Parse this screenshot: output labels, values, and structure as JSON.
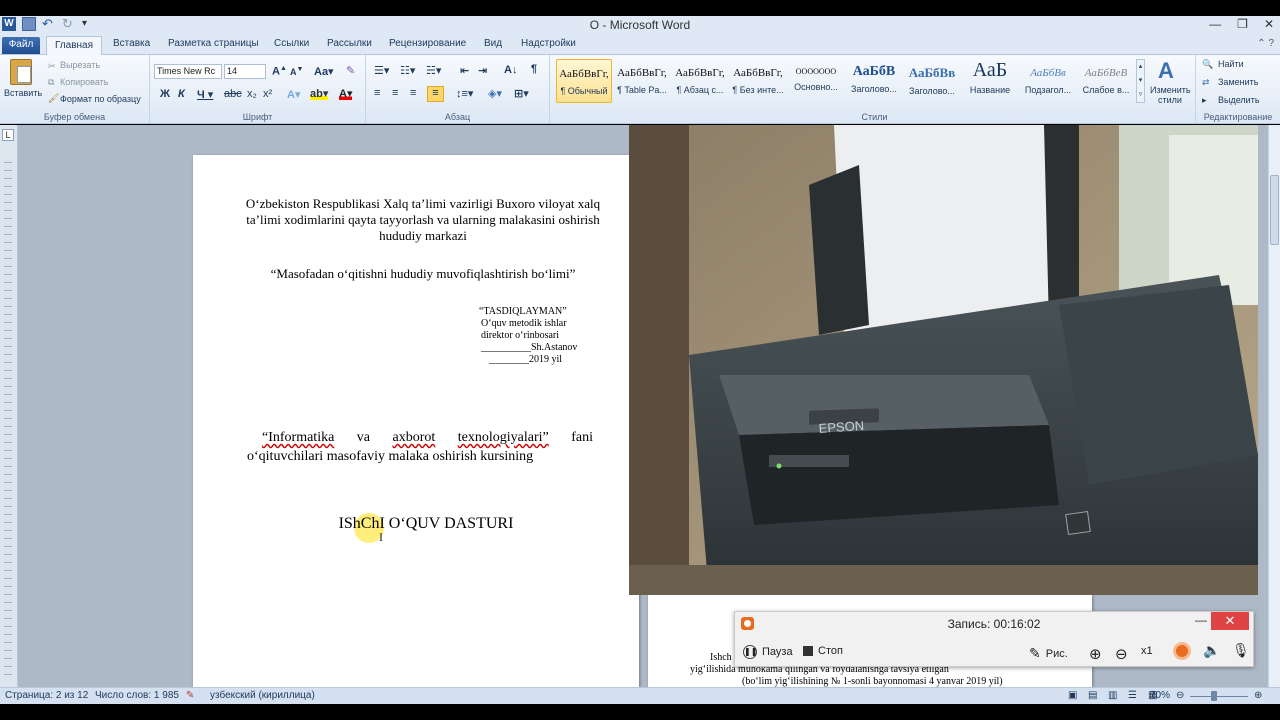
{
  "window": {
    "title": "O  -  Microsoft Word"
  },
  "tabs": [
    {
      "id": "file",
      "label": "Файл"
    },
    {
      "id": "home",
      "label": "Главная"
    },
    {
      "id": "insert",
      "label": "Вставка"
    },
    {
      "id": "layout",
      "label": "Разметка страницы"
    },
    {
      "id": "refs",
      "label": "Ссылки"
    },
    {
      "id": "mailings",
      "label": "Рассылки"
    },
    {
      "id": "review",
      "label": "Рецензирование"
    },
    {
      "id": "view",
      "label": "Вид"
    },
    {
      "id": "addins",
      "label": "Надстройки"
    }
  ],
  "clipboard": {
    "paste": "Вставить",
    "cut": "Вырезать",
    "copy": "Копировать",
    "format_painter": "Формат по образцу",
    "label": "Буфер обмена"
  },
  "font": {
    "name": "Times New Rc",
    "size": "14",
    "label": "Шрифт"
  },
  "paragraph": {
    "label": "Абзац"
  },
  "styles": {
    "label": "Стили",
    "items": [
      {
        "preview": "АаБбВвГг,",
        "name": "¶ Обычный"
      },
      {
        "preview": "АаБбВвГг,",
        "name": "¶ Table Pa..."
      },
      {
        "preview": "АаБбВвГг,",
        "name": "¶ Абзац с..."
      },
      {
        "preview": "АаБбВвГг,",
        "name": "¶ Без инте..."
      },
      {
        "preview": "ООООООО",
        "name": "Основно..."
      },
      {
        "preview": "АаБбВ",
        "name": "Заголово..."
      },
      {
        "preview": "АаБбВв",
        "name": "Заголово..."
      },
      {
        "preview": "АаБ",
        "name": "Название"
      },
      {
        "preview": "АаБбВв",
        "name": "Подзагол..."
      },
      {
        "preview": "АаБбВеВ",
        "name": "Слабое в..."
      }
    ],
    "change_styles": "Изменить стили"
  },
  "editing": {
    "label": "Редактирование",
    "find": "Найти",
    "replace": "Заменить",
    "select": "Выделить"
  },
  "document": {
    "org": "O‘zbekiston Respublikasi Xalq ta’limi vazirligi Buxoro viloyat xalq ta’limi xodimlarini qayta tayyorlash va ularning malakasini oshirish hududiy markazi",
    "dept": "“Masofadan o‘qitishni hududiy muvofiqlashtirish bo‘limi”",
    "approve": [
      "“TASDIQLAYMAN”",
      "O‘quv metodik ishlar",
      "direktor o‘rinbosari",
      "__________Sh.Astanov",
      "________2019 yil"
    ],
    "course_line1": [
      "“Informatika",
      "va",
      "axborot",
      "texnologiyalari”",
      "fani"
    ],
    "course_line2": "o‘qituvchilari masofaviy malaka oshirish kursining",
    "program_title": "IShChI  O‘QUV DASTURI"
  },
  "page2": {
    "line1": "Ishch",
    "line2": "yig‘ilishida muhokama qilingan va foydalanishga tavsiya etilgan",
    "line3": "(bo‘lim yig‘ilishining  № 1-sonli bayonnomasi 4 yanvar 2019 yil)"
  },
  "recorder": {
    "title": "Запись:  00:16:02",
    "pause": "Пауза",
    "stop": "Стоп",
    "draw": "Рис.",
    "zoom_level": "x1"
  },
  "status": {
    "page": "Страница: 2 из 12",
    "words": "Число слов: 1 985",
    "language": "узбекский (кириллица)",
    "zoom": "70%"
  }
}
